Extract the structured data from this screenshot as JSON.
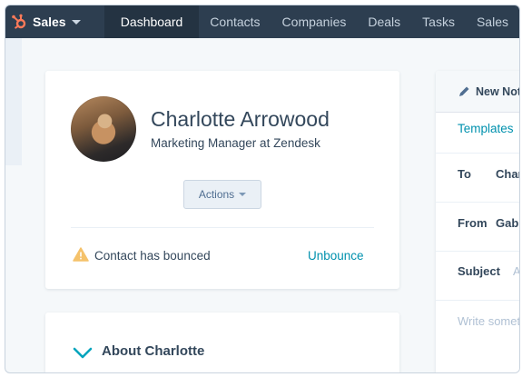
{
  "nav": {
    "brand": "Sales",
    "items": [
      "Dashboard",
      "Contacts",
      "Companies",
      "Deals",
      "Tasks",
      "Sales"
    ],
    "active": "Dashboard"
  },
  "contact": {
    "name": "Charlotte Arrowood",
    "title": "Marketing Manager at Zendesk",
    "actions_label": "Actions",
    "bounce_message": "Contact has bounced",
    "unbounce_label": "Unbounce"
  },
  "about": {
    "title": "About Charlotte"
  },
  "compose": {
    "new_note": "New Note",
    "templates": "Templates",
    "to_label": "To",
    "to_value": "Charlotte",
    "from_label": "From",
    "from_value": "Gabriel",
    "subject_label": "Subject",
    "subject_placeholder": "Add subject",
    "body_placeholder": "Write something"
  },
  "colors": {
    "nav_bg": "#2d3e50",
    "accent": "#0091ae",
    "warning": "#f5c26b",
    "chevron": "#00a4bd",
    "brand_logo": "#ff7a59"
  },
  "icons": [
    "hubspot-sprocket-icon",
    "caret-down-icon",
    "warning-icon",
    "chevron-down-icon",
    "pencil-icon"
  ]
}
